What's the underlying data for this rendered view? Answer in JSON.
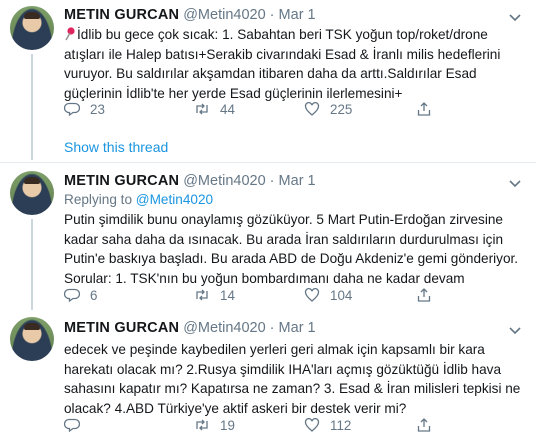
{
  "tweets": [
    {
      "name": "METIN GURCAN",
      "handle": "@Metin4020",
      "sep": "·",
      "date": "Mar 1",
      "lines": [
        "İdlib bu gece çok sıcak: 1. Sabahtan beri TSK yoğun top/roket/drone",
        "atışları ile Halep batısı+Serakib civarındaki Esad & İranlı milis hedeflerini",
        "vuruyor. Bu saldırılar akşamdan itibaren daha da arttı.Saldırılar Esad",
        "güçlerinin İdlib'te her yerde Esad güçlerinin ilerlemesini+"
      ],
      "replies": "23",
      "retweets": "44",
      "likes": "225",
      "show_thread": "Show this thread"
    },
    {
      "name": "METIN GURCAN",
      "handle": "@Metin4020",
      "sep": "·",
      "date": "Mar 1",
      "replying_prefix": "Replying to",
      "replying_to": "@Metin4020",
      "lines": [
        "Putin şimdilik bunu onaylamış gözüküyor. 5 Mart Putin-Erdoğan zirvesine",
        "kadar saha daha da ısınacak. Bu arada İran saldırıların durdurulması için",
        "Putin'e baskıya başladı. Bu arada ABD de Doğu Akdeniz'e gemi gönderiyor.",
        "Sorular: 1. TSK'nın bu yoğun bombardımanı daha ne kadar devam"
      ],
      "replies": "6",
      "retweets": "14",
      "likes": "104"
    },
    {
      "name": "METIN GURCAN",
      "handle": "@Metin4020",
      "sep": "·",
      "date": "Mar 1",
      "lines": [
        "edecek ve peşinde kaybedilen yerleri geri almak için kapsamlı bir kara",
        "harekatı olacak mı? 2.Rusya şimdilik IHA'ları açmış gözüktüğü İdlib hava",
        "sahasını kapatır mı? Kapatırsa ne zaman? 3. Esad & İran milisleri tepkisi ne",
        "olacak? 4.ABD Türkiye'ye aktif askeri bir destek verir mi?"
      ],
      "replies": "",
      "retweets": "19",
      "likes": "112"
    }
  ],
  "icons": {
    "pin": "pushpin-icon",
    "reply": "reply-icon",
    "retweet": "retweet-icon",
    "like": "heart-icon",
    "share": "share-icon",
    "menu": "chevron-down-icon"
  },
  "colors": {
    "text": "#14171a",
    "muted": "#657786",
    "link": "#1b95e0",
    "divider": "#e6ecf0",
    "pin": "#e0245e"
  }
}
